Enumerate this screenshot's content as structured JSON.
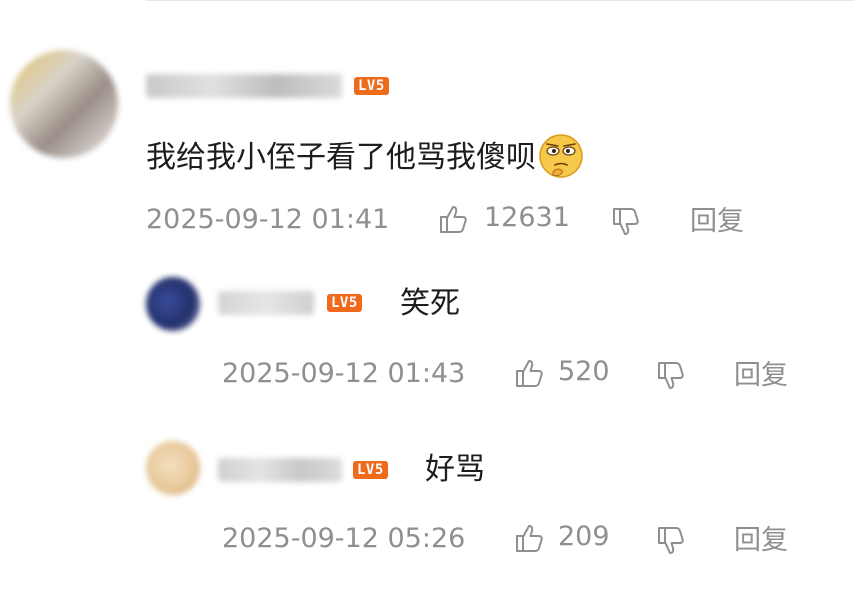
{
  "comments": [
    {
      "level": "LV5",
      "text": "我给我小侄子看了他骂我傻呗",
      "emoji": "thinking-face-emoji",
      "timestamp": "2025-09-12 01:41",
      "likes": "12631",
      "reply_label": "回复"
    },
    {
      "level": "LV5",
      "text": "笑死",
      "timestamp": "2025-09-12 01:43",
      "likes": "520",
      "reply_label": "回复"
    },
    {
      "level": "LV5",
      "text": "好骂",
      "timestamp": "2025-09-12 05:26",
      "likes": "209",
      "reply_label": "回复"
    }
  ],
  "colors": {
    "level_badge": "#f06a1b",
    "meta_text": "#8f8f8f"
  }
}
